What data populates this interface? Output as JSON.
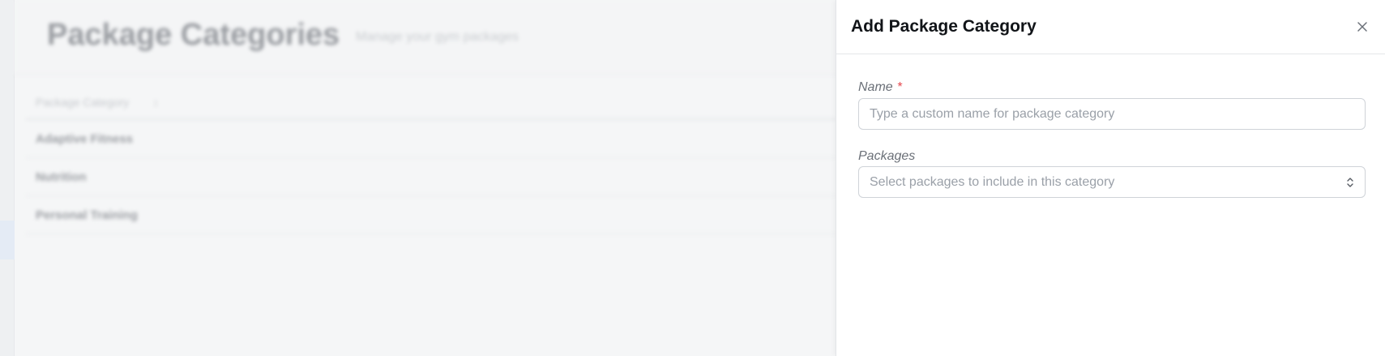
{
  "background": {
    "page_title": "Package Categories",
    "page_subtitle": "Manage your gym packages",
    "table": {
      "column_header": "Package Category",
      "sort_icon": "↕",
      "rows": [
        "Adaptive Fitness",
        "Nutrition",
        "Personal Training"
      ]
    }
  },
  "drawer": {
    "title": "Add Package Category",
    "close_icon": "close-icon",
    "fields": {
      "name": {
        "label": "Name",
        "required_mark": "*",
        "value": "",
        "placeholder": "Type a custom name for package category"
      },
      "packages": {
        "label": "Packages",
        "placeholder": "Select packages to include in this category",
        "icon": "chevron-up-down-icon"
      }
    }
  },
  "colors": {
    "required": "#e5484d",
    "title": "#111418",
    "label": "#6b7078",
    "placeholder": "#9aa0a8",
    "border": "#cfd3d8"
  }
}
